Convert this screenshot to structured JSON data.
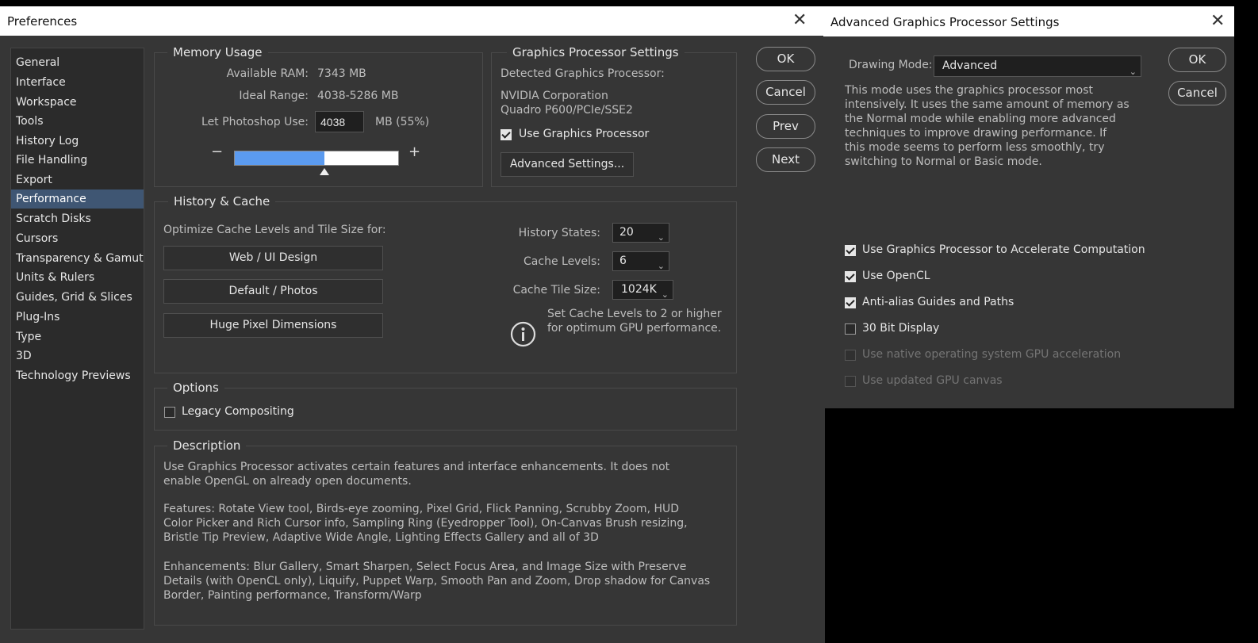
{
  "prefs": {
    "title": "Preferences",
    "sidebar": [
      {
        "label": "General"
      },
      {
        "label": "Interface"
      },
      {
        "label": "Workspace"
      },
      {
        "label": "Tools"
      },
      {
        "label": "History Log"
      },
      {
        "label": "File Handling"
      },
      {
        "label": "Export"
      },
      {
        "label": "Performance"
      },
      {
        "label": "Scratch Disks"
      },
      {
        "label": "Cursors"
      },
      {
        "label": "Transparency & Gamut"
      },
      {
        "label": "Units & Rulers"
      },
      {
        "label": "Guides, Grid & Slices"
      },
      {
        "label": "Plug-Ins"
      },
      {
        "label": "Type"
      },
      {
        "label": "3D"
      },
      {
        "label": "Technology Previews"
      }
    ],
    "selected_item": "Performance",
    "memory": {
      "title": "Memory Usage",
      "available_label": "Available RAM:",
      "available_value": "7343 MB",
      "ideal_label": "Ideal Range:",
      "ideal_value": "4038-5286 MB",
      "let_use_label": "Let Photoshop Use:",
      "let_use_value": "4038",
      "let_use_suffix": "MB (55%)",
      "slider_fraction": 0.55,
      "minus": "−",
      "plus": "+"
    },
    "gpu": {
      "title": "Graphics Processor Settings",
      "detected_label": "Detected Graphics Processor:",
      "vendor": "NVIDIA Corporation",
      "model": "Quadro P600/PCIe/SSE2",
      "use_gpu_label": "Use Graphics Processor",
      "use_gpu_checked": true,
      "advanced_button": "Advanced Settings..."
    },
    "buttons": {
      "ok": "OK",
      "cancel": "Cancel",
      "prev": "Prev",
      "next": "Next"
    },
    "history_cache": {
      "title": "History & Cache",
      "optimize_label": "Optimize Cache Levels and Tile Size for:",
      "opt_buttons": [
        "Web / UI Design",
        "Default / Photos",
        "Huge Pixel Dimensions"
      ],
      "history_states_label": "History States:",
      "history_states_value": "20",
      "cache_levels_label": "Cache Levels:",
      "cache_levels_value": "6",
      "tile_size_label": "Cache Tile Size:",
      "tile_size_value": "1024K",
      "info_text_1": "Set Cache Levels to 2 or higher",
      "info_text_2": "for optimum GPU performance."
    },
    "options": {
      "title": "Options",
      "legacy_label": "Legacy Compositing",
      "legacy_checked": false
    },
    "description": {
      "title": "Description",
      "para1": "Use Graphics Processor activates certain features and interface enhancements. It does not enable OpenGL on already open documents.",
      "para2": "Features: Rotate View tool, Birds-eye zooming, Pixel Grid, Flick Panning, Scrubby Zoom, HUD Color Picker and Rich Cursor info, Sampling Ring (Eyedropper Tool), On-Canvas Brush resizing, Bristle Tip Preview, Adaptive Wide Angle, Lighting Effects Gallery and all of 3D",
      "para3": "Enhancements: Blur Gallery, Smart Sharpen, Select Focus Area, and Image Size with Preserve Details (with OpenCL only), Liquify, Puppet Warp, Smooth Pan and Zoom, Drop shadow for Canvas Border, Painting performance, Transform/Warp"
    }
  },
  "advanced": {
    "title": "Advanced Graphics Processor Settings",
    "drawing_mode_label": "Drawing Mode:",
    "drawing_mode_value": "Advanced",
    "mode_description": "This mode uses the graphics processor most intensively.  It uses the same amount of memory as the Normal mode while enabling more advanced techniques to improve drawing performance.  If this mode seems to perform less smoothly, try switching to Normal or Basic mode.",
    "buttons": {
      "ok": "OK",
      "cancel": "Cancel"
    },
    "options": [
      {
        "label": "Use Graphics Processor to Accelerate Computation",
        "checked": true,
        "disabled": false
      },
      {
        "label": "Use OpenCL",
        "checked": true,
        "disabled": false
      },
      {
        "label": "Anti-alias Guides and Paths",
        "checked": true,
        "disabled": false
      },
      {
        "label": "30 Bit Display",
        "checked": false,
        "disabled": false
      },
      {
        "label": "Use native operating system GPU acceleration",
        "checked": false,
        "disabled": true
      },
      {
        "label": "Use updated GPU canvas",
        "checked": false,
        "disabled": true
      }
    ]
  },
  "colors": {
    "selection": "#3f5673",
    "slider_fill": "#5b9bf0"
  }
}
